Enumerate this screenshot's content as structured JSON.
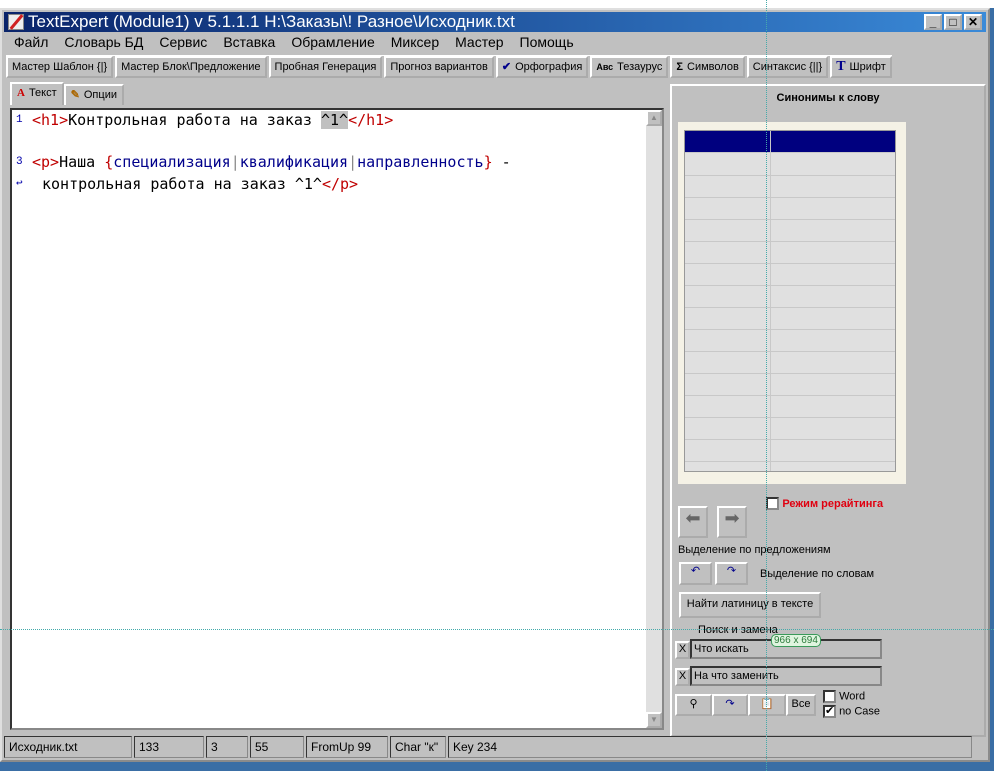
{
  "window": {
    "title": "TextExpert (Module1) v 5.1.1.1    H:\\Заказы\\! Разное\\Исходник.txt"
  },
  "menu": [
    "Файл",
    "Словарь БД",
    "Сервис",
    "Вставка",
    "Обрамление",
    "Миксер",
    "Мастер",
    "Помощь"
  ],
  "toolbar": [
    {
      "label": "Мастер Шаблон {|}",
      "icon": ""
    },
    {
      "label": "Мастер Блок\\Предложение",
      "icon": ""
    },
    {
      "label": "Пробная Генерация",
      "icon": ""
    },
    {
      "label": "Прогноз вариантов",
      "icon": ""
    },
    {
      "label": "Орфография",
      "icon": "✔"
    },
    {
      "label": "Тезаурус",
      "icon": "Авс"
    },
    {
      "label": "Символов",
      "icon": "Σ"
    },
    {
      "label": "Синтаксис {||}",
      "icon": ""
    },
    {
      "label": "Шрифт",
      "icon": "T"
    }
  ],
  "tabs": [
    {
      "label": "Текст",
      "icon": "A"
    },
    {
      "label": "Опции",
      "icon": "✎"
    }
  ],
  "editor": {
    "line_numbers": [
      "1",
      "3"
    ],
    "line1": {
      "open": "<h1>",
      "text": "Контрольная работа на заказ ",
      "hl": "^1^",
      "close": "</h1>"
    },
    "line3": {
      "open": "<p>",
      "text": "Наша ",
      "lb": "{",
      "a": "специализация",
      "b": "квалификация",
      "c": "направленность",
      "rb": "}",
      "dash": " -"
    },
    "line4": {
      "text": "контрольная работа на заказ ^1^",
      "close": "</p>"
    }
  },
  "panel": {
    "title": "Синонимы к слову",
    "rewrite_mode": "Режим рерайтинга",
    "by_sentences": "Выделение по предложениям",
    "by_words": "Выделение по словам",
    "find_latin": "Найти латиницу в тексте",
    "search_replace": "Поиск и замена",
    "find_field": "Что искать",
    "replace_field": "На что заменить",
    "clear": "X",
    "all_btn": "Все",
    "word": "Word",
    "nocase": "no Case",
    "nocase_checked": true,
    "word_checked": false
  },
  "status": [
    "Исходник.txt",
    "133",
    "3",
    "55",
    "FromUp  99",
    "Char \"к\"",
    "Key 234"
  ],
  "tooltip": "966 x 694"
}
